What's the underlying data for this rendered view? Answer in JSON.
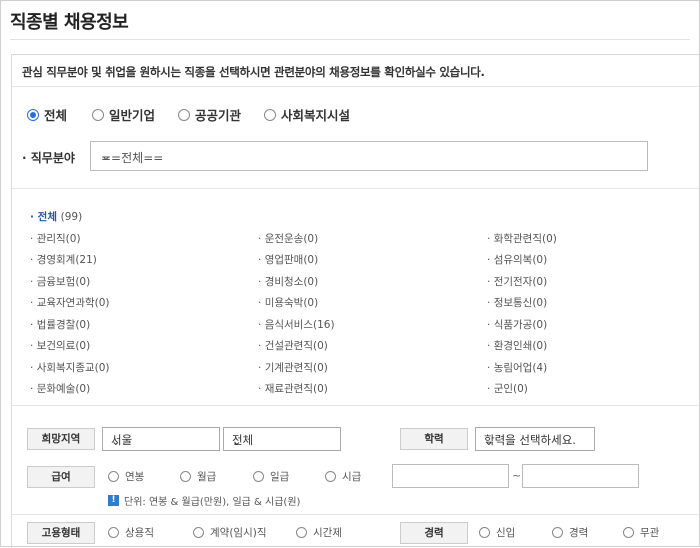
{
  "page": {
    "title": "직종별 채용정보"
  },
  "notice": "관심 직무분야 및 취업을 원하시는 직종을 선택하시면 관련분야의 채용정보를 확인하실수 있습니다.",
  "org_types": [
    {
      "label": "전체",
      "selected": true
    },
    {
      "label": "일반기업",
      "selected": false
    },
    {
      "label": "공공기관",
      "selected": false
    },
    {
      "label": "사회복지시설",
      "selected": false
    }
  ],
  "field": {
    "label": "직무분야",
    "value": "==전체=="
  },
  "categories": {
    "all": {
      "label": "전체",
      "count": "(99)"
    },
    "col1": [
      "관리직(0)",
      "경영회계(21)",
      "금융보험(0)",
      "교육자연과학(0)",
      "법률경찰(0)",
      "보건의료(0)",
      "사회복지종교(0)",
      "문화예술(0)"
    ],
    "col2": [
      "운전운송(0)",
      "영업판매(0)",
      "경비청소(0)",
      "미용숙박(0)",
      "음식서비스(16)",
      "건설관련직(0)",
      "기계관련직(0)",
      "재료관련직(0)"
    ],
    "col3": [
      "화학관련직(0)",
      "섬유의복(0)",
      "전기전자(0)",
      "정보통신(0)",
      "식품가공(0)",
      "환경인쇄(0)",
      "농림어업(4)",
      "군인(0)"
    ]
  },
  "filters": {
    "region": {
      "label": "희망지역",
      "city": "서울",
      "district": "전체"
    },
    "education": {
      "label": "학력",
      "value": "학력을 선택하세요."
    },
    "salary": {
      "label": "급여",
      "options": [
        "연봉",
        "월급",
        "일급",
        "시급"
      ],
      "tilde": "~",
      "hint": "단위: 연봉 & 월급(만원), 일급 & 시급(원)"
    },
    "employment": {
      "label": "고용형태",
      "options": [
        "상용직",
        "계약(임시)직",
        "시간제"
      ]
    },
    "career": {
      "label": "경력",
      "options": [
        "신입",
        "경력",
        "무관"
      ]
    }
  },
  "icons": {
    "info": "info-icon",
    "chevron": "chevron-down-icon"
  },
  "colors": {
    "accent": "#2a6fd1",
    "active_category": "#2358a8"
  }
}
